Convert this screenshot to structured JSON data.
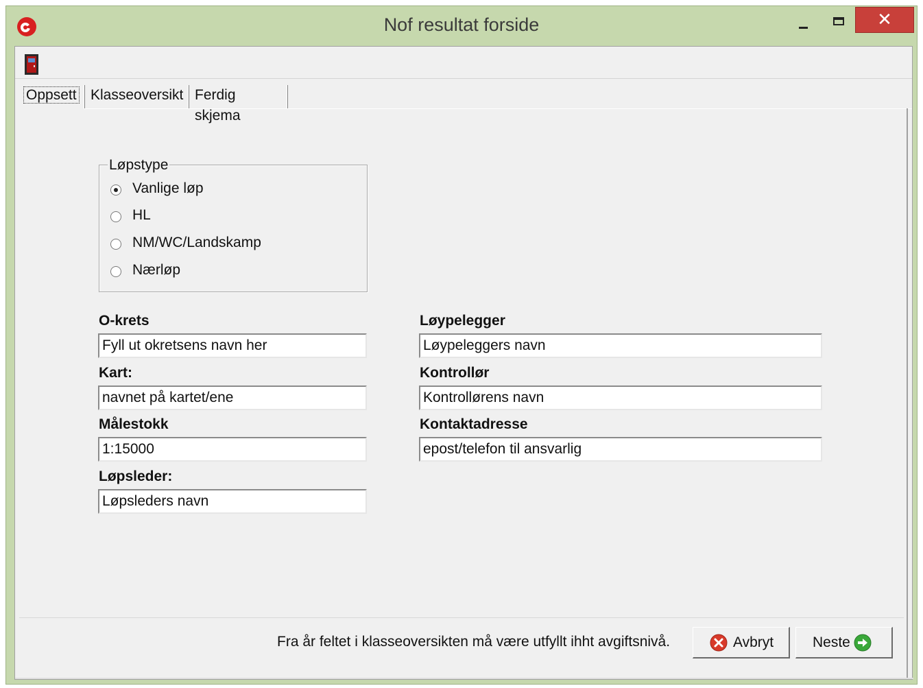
{
  "window": {
    "title": "Nof resultat forside",
    "close_glyph": "✕"
  },
  "tabs": [
    {
      "label": "Oppsett",
      "selected": true
    },
    {
      "label": "Klasseoversikt",
      "selected": false
    },
    {
      "label": "Ferdig skjema",
      "selected": false
    }
  ],
  "lopstype": {
    "legend": "Løpstype",
    "options": [
      {
        "label": "Vanlige løp",
        "checked": true
      },
      {
        "label": "HL",
        "checked": false
      },
      {
        "label": "NM/WC/Landskamp",
        "checked": false
      },
      {
        "label": "Nærløp",
        "checked": false
      }
    ]
  },
  "fields": {
    "okrets": {
      "label": "O-krets",
      "value": "Fyll ut okretsens navn her"
    },
    "kart": {
      "label": "Kart:",
      "value": "navnet på kartet/ene"
    },
    "malestokk": {
      "label": "Målestokk",
      "value": "1:15000"
    },
    "lopsleder": {
      "label": "Løpsleder:",
      "value": "Løpsleders navn"
    },
    "loypelegger": {
      "label": "Løypelegger",
      "value": "Løypeleggers navn"
    },
    "kontrollor": {
      "label": "Kontrollør",
      "value": "Kontrollørens navn"
    },
    "kontaktadresse": {
      "label": "Kontaktadresse",
      "value": "epost/telefon til ansvarlig"
    }
  },
  "footer": {
    "note": "Fra år feltet i klasseoversikten må være utfyllt ihht avgiftsnivå.",
    "cancel_label": "Avbryt",
    "next_label": "Neste"
  },
  "icons": {
    "app": "app-logo-icon",
    "toolbar": "exit-door-icon",
    "cancel": "cancel-icon",
    "next": "arrow-right-icon"
  },
  "colors": {
    "title_bar": "#c6d8ad",
    "close_button": "#c8403a",
    "cancel_icon": "#d83a2a",
    "next_icon": "#3aa83a"
  }
}
